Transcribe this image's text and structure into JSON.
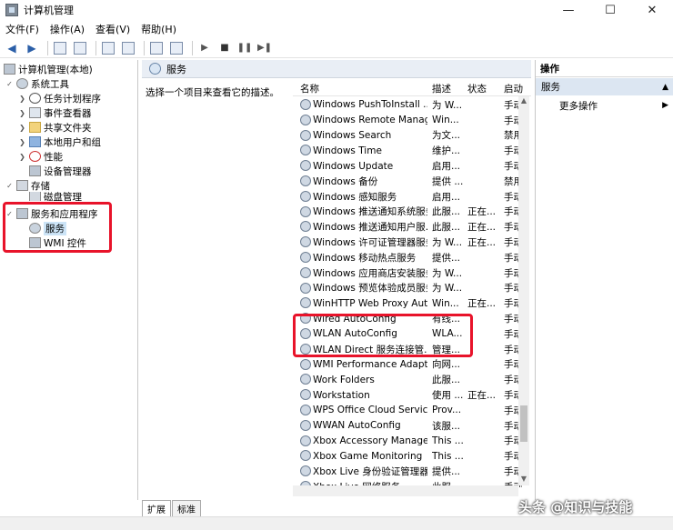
{
  "window": {
    "title": "计算机管理",
    "minimize": "—",
    "maximize": "☐",
    "close": "✕"
  },
  "menu": [
    "文件(F)",
    "操作(A)",
    "查看(V)",
    "帮助(H)"
  ],
  "tree": {
    "root": "计算机管理(本地)",
    "system_tools": "系统工具",
    "task_scheduler": "任务计划程序",
    "event_viewer": "事件查看器",
    "shared_folders": "共享文件夹",
    "local_users": "本地用户和组",
    "performance": "性能",
    "device_manager": "设备管理器",
    "storage": "存储",
    "disk_management": "磁盘管理",
    "services_apps": "服务和应用程序",
    "services": "服务",
    "wmi": "WMI 控件"
  },
  "center": {
    "header": "服务",
    "description": "选择一个项目来查看它的描述。",
    "columns": {
      "name": "名称",
      "desc": "描述",
      "status": "状态",
      "start": "启动"
    },
    "services": [
      {
        "name": "Windows PushToInstall ...",
        "desc": "为 W...",
        "status": "",
        "start": "手动"
      },
      {
        "name": "Windows Remote Manag...",
        "desc": "Win...",
        "status": "",
        "start": "手动"
      },
      {
        "name": "Windows Search",
        "desc": "为文...",
        "status": "",
        "start": "禁用"
      },
      {
        "name": "Windows Time",
        "desc": "维护...",
        "status": "",
        "start": "手动"
      },
      {
        "name": "Windows Update",
        "desc": "启用...",
        "status": "",
        "start": "手动"
      },
      {
        "name": "Windows 备份",
        "desc": "提供 ...",
        "status": "",
        "start": "禁用"
      },
      {
        "name": "Windows 感知服务",
        "desc": "启用...",
        "status": "",
        "start": "手动"
      },
      {
        "name": "Windows 推送通知系统服务",
        "desc": "此服...",
        "status": "正在...",
        "start": "手动"
      },
      {
        "name": "Windows 推送通知用户服...",
        "desc": "此服...",
        "status": "正在...",
        "start": "手动"
      },
      {
        "name": "Windows 许可证管理器服务",
        "desc": "为 W...",
        "status": "正在...",
        "start": "手动"
      },
      {
        "name": "Windows 移动热点服务",
        "desc": "提供...",
        "status": "",
        "start": "手动"
      },
      {
        "name": "Windows 应用商店安装服务",
        "desc": "为 W...",
        "status": "",
        "start": "手动"
      },
      {
        "name": "Windows 预览体验成员服务",
        "desc": "为 W...",
        "status": "",
        "start": "手动"
      },
      {
        "name": "WinHTTP Web Proxy Aut...",
        "desc": "Win...",
        "status": "正在...",
        "start": "手动"
      },
      {
        "name": "Wired AutoConfig",
        "desc": "有线...",
        "status": "",
        "start": "手动"
      },
      {
        "name": "WLAN AutoConfig",
        "desc": "WLA...",
        "status": "",
        "start": "手动"
      },
      {
        "name": "WLAN Direct 服务连接管...",
        "desc": "管理...",
        "status": "",
        "start": "手动"
      },
      {
        "name": "WMI Performance Adapt...",
        "desc": "向网...",
        "status": "",
        "start": "手动"
      },
      {
        "name": "Work Folders",
        "desc": "此服...",
        "status": "",
        "start": "手动"
      },
      {
        "name": "Workstation",
        "desc": "使用 ...",
        "status": "正在...",
        "start": "手动"
      },
      {
        "name": "WPS Office Cloud Service",
        "desc": "Prov...",
        "status": "",
        "start": "手动"
      },
      {
        "name": "WWAN AutoConfig",
        "desc": "该服...",
        "status": "",
        "start": "手动"
      },
      {
        "name": "Xbox Accessory Manage...",
        "desc": "This ...",
        "status": "",
        "start": "手动"
      },
      {
        "name": "Xbox Game Monitoring",
        "desc": "This ...",
        "status": "",
        "start": "手动"
      },
      {
        "name": "Xbox Live 身份验证管理器",
        "desc": "提供...",
        "status": "",
        "start": "手动"
      },
      {
        "name": "Xbox Live 网络服务",
        "desc": "此服...",
        "status": "",
        "start": "手动"
      }
    ]
  },
  "tabs": [
    "扩展",
    "标准"
  ],
  "actions": {
    "title": "操作",
    "section": "服务",
    "more": "更多操作"
  },
  "watermark": "头条 @知识与技能"
}
